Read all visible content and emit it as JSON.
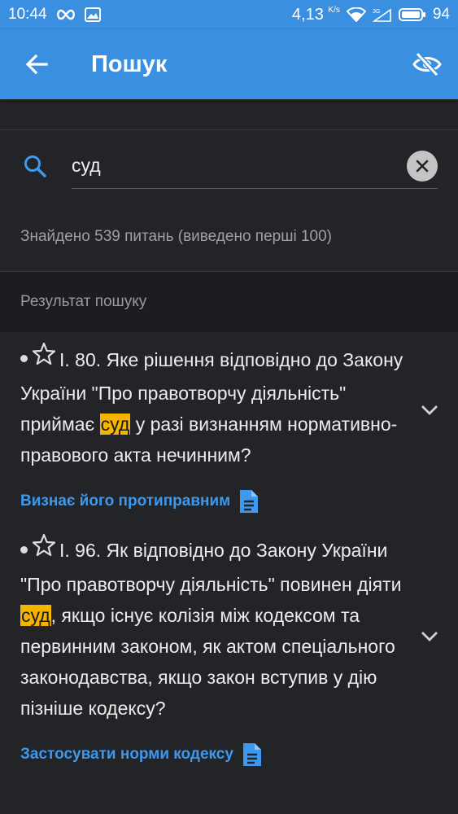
{
  "status_bar": {
    "time": "10:44",
    "speed": "4,13",
    "speed_unit": "K/s",
    "network": "3G",
    "battery": "94"
  },
  "app_bar": {
    "title": "Пошук"
  },
  "search": {
    "query": "суд"
  },
  "found_text": "Знайдено 539 питань (виведено перші 100)",
  "results_header": "Результат пошуку",
  "results": [
    {
      "q_before": "І. 80. Яке рішення відповідно до Закону України \"Про правотворчу діяльність\" приймає ",
      "q_highlight": "суд",
      "q_after": " у разі визнанням нормативно-правового акта нечинним?",
      "answer": "Визнає його протиправним"
    },
    {
      "q_before": "І. 96. Як відповідно до Закону України \"Про правотворчу діяльність\" повинен діяти ",
      "q_highlight": "суд",
      "q_after": ", якщо існує колізія між кодексом та первинним законом, як актом спеціального законодавства, якщо закон вступив у дію пізніше кодексу?",
      "answer": "Застосувати норми кодексу"
    }
  ],
  "colors": {
    "accent": "#3a8fe0",
    "link": "#3d99ee",
    "highlight": "#f5b400",
    "background": "#232427"
  }
}
